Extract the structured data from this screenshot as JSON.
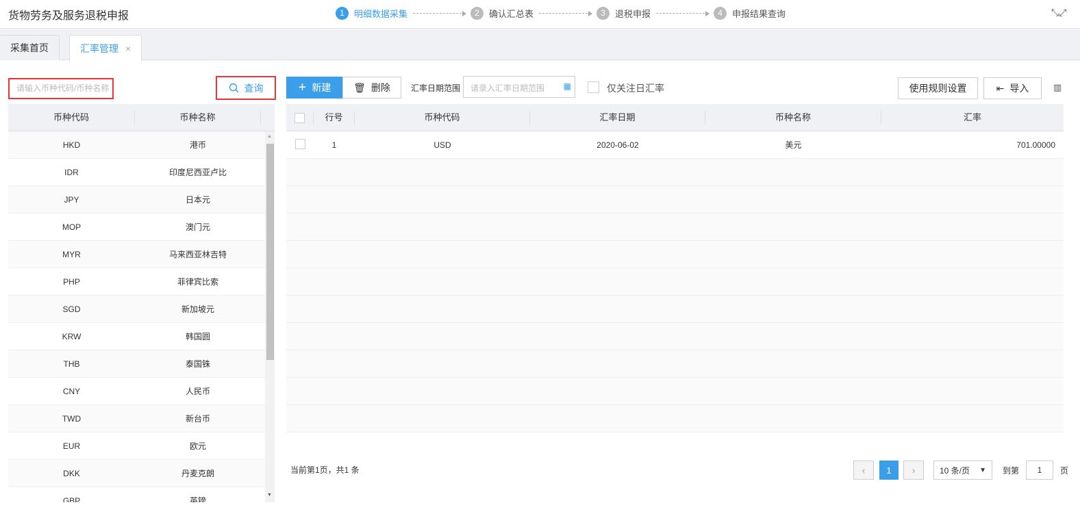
{
  "header": {
    "title": "货物劳务及服务退税申报",
    "steps": [
      {
        "num": "1",
        "label": "明细数据采集"
      },
      {
        "num": "2",
        "label": "确认汇总表"
      },
      {
        "num": "3",
        "label": "退税申报"
      },
      {
        "num": "4",
        "label": "申报结果查询"
      }
    ]
  },
  "tabs": [
    {
      "label": "采集首页"
    },
    {
      "label": "汇率管理",
      "close": "×"
    }
  ],
  "left": {
    "search_placeholder": "请输入币种代码/币种名称",
    "query_label": "查询",
    "columns": [
      "币种代码",
      "币种名称"
    ],
    "rows": [
      [
        "HKD",
        "港币"
      ],
      [
        "IDR",
        "印度尼西亚卢比"
      ],
      [
        "JPY",
        "日本元"
      ],
      [
        "MOP",
        "澳门元"
      ],
      [
        "MYR",
        "马来西亚林吉特"
      ],
      [
        "PHP",
        "菲律宾比索"
      ],
      [
        "SGD",
        "新加坡元"
      ],
      [
        "KRW",
        "韩国圆"
      ],
      [
        "THB",
        "泰国铢"
      ],
      [
        "CNY",
        "人民币"
      ],
      [
        "TWD",
        "新台币"
      ],
      [
        "EUR",
        "欧元"
      ],
      [
        "DKK",
        "丹麦克朗"
      ],
      [
        "GBP",
        "英镑"
      ]
    ]
  },
  "toolbar": {
    "new_label": "新建",
    "delete_label": "删除",
    "date_range_label": "汇率日期范围",
    "date_placeholder": "请录入汇率日期范围",
    "only_label": "仅关注日汇率",
    "rules_label": "使用规则设置",
    "import_label": "导入"
  },
  "table": {
    "columns": [
      "行号",
      "币种代码",
      "汇率日期",
      "币种名称",
      "汇率"
    ],
    "rows": [
      [
        "1",
        "USD",
        "2020-06-02",
        "美元",
        "701.00000"
      ]
    ]
  },
  "pagination": {
    "summary": "当前第1页，共1 条",
    "current": "1",
    "page_size": "10 条/页",
    "goto_label": "到第",
    "goto_value": "1",
    "page_suffix": "页"
  },
  "colors": {
    "accent": "#3a9fe8",
    "highlight": "#e33333"
  }
}
